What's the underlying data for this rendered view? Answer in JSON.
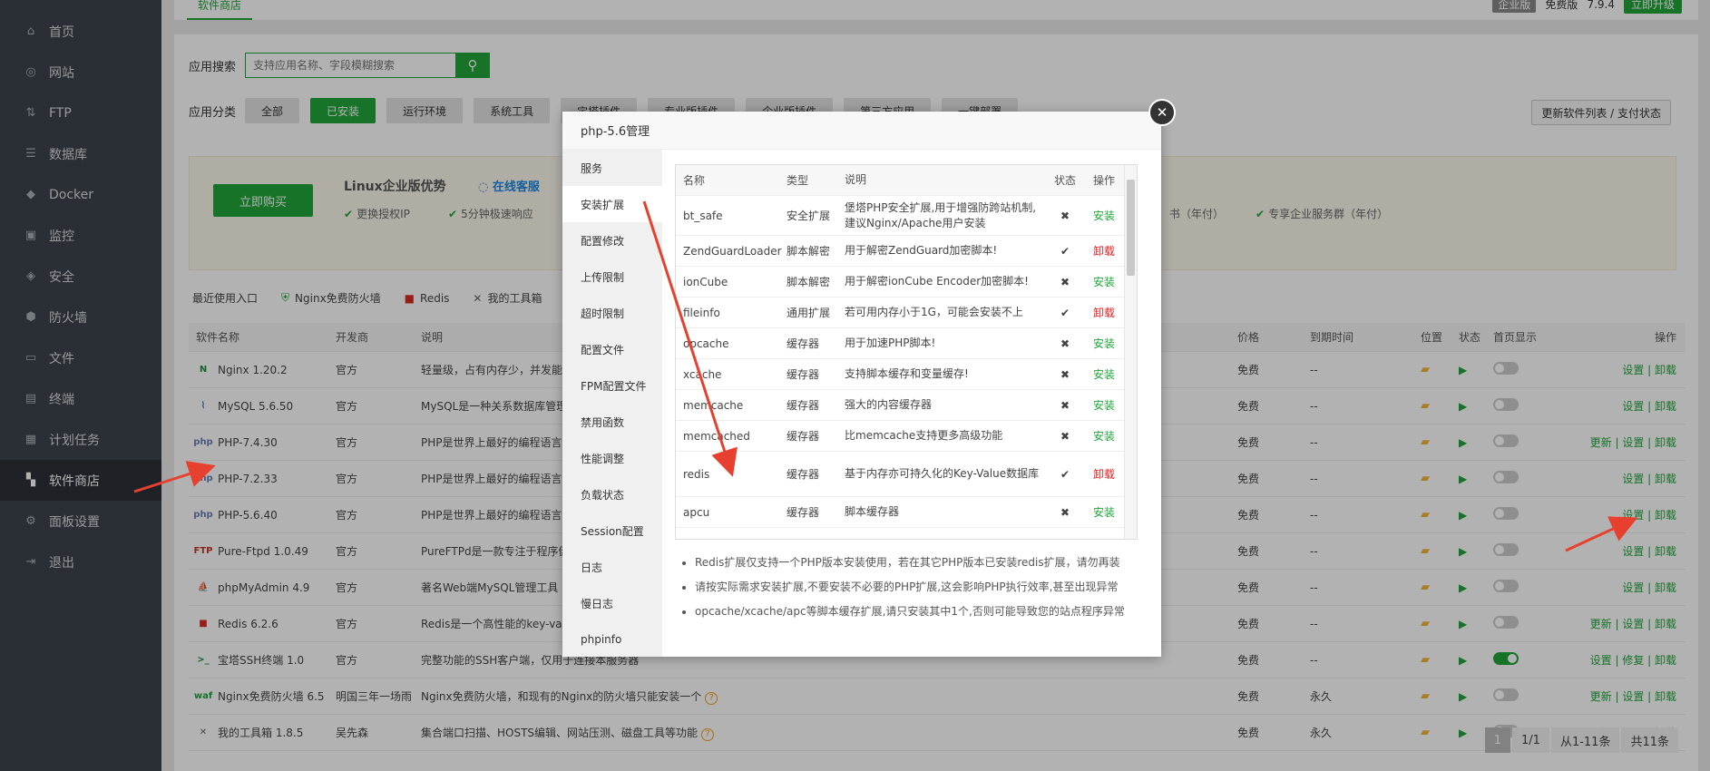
{
  "sidebar": {
    "items": [
      {
        "label": "首页",
        "icon": "home-icon",
        "glyph": "⌂"
      },
      {
        "label": "网站",
        "icon": "globe-icon",
        "glyph": "◎"
      },
      {
        "label": "FTP",
        "icon": "ftp-icon",
        "glyph": "⇅"
      },
      {
        "label": "数据库",
        "icon": "database-icon",
        "glyph": "☰"
      },
      {
        "label": "Docker",
        "icon": "docker-icon",
        "glyph": "◆"
      },
      {
        "label": "监控",
        "icon": "monitor-icon",
        "glyph": "▣"
      },
      {
        "label": "安全",
        "icon": "shield-check-icon",
        "glyph": "◈"
      },
      {
        "label": "防火墙",
        "icon": "firewall-icon",
        "glyph": "⬢"
      },
      {
        "label": "文件",
        "icon": "folder-icon",
        "glyph": "▭"
      },
      {
        "label": "终端",
        "icon": "terminal-icon",
        "glyph": "▤"
      },
      {
        "label": "计划任务",
        "icon": "calendar-icon",
        "glyph": "▦"
      },
      {
        "label": "软件商店",
        "icon": "app-store-icon",
        "glyph": "▚"
      },
      {
        "label": "面板设置",
        "icon": "settings-icon",
        "glyph": "⚙"
      },
      {
        "label": "退出",
        "icon": "logout-icon",
        "glyph": "⇥"
      }
    ],
    "active_index": 11
  },
  "topbar": {
    "tab": "软件商店",
    "edition": "企业版",
    "version_label": "免费版",
    "version": "7.9.4",
    "upgrade": "立即升级"
  },
  "search": {
    "label": "应用搜索",
    "placeholder": "支持应用名称、字段模糊搜索"
  },
  "category": {
    "label": "应用分类",
    "items": [
      "全部",
      "已安装",
      "运行环境",
      "系统工具",
      "宝塔插件",
      "专业版插件",
      "企业版插件",
      "第三方应用",
      "一键部署"
    ],
    "active_index": 1,
    "refresh": "更新软件列表 / 支付状态"
  },
  "promo": {
    "buy": "立即购买",
    "title": "Linux企业版优势",
    "service": "在线客服",
    "features": [
      "更换授权IP",
      "5分钟极速响应",
      "书（年付）",
      "专享企业服务群（年付）"
    ]
  },
  "recent": {
    "label": "最近使用入口",
    "items": [
      "Nginx免费防火墙",
      "Redis",
      "我的工具箱"
    ]
  },
  "table": {
    "headers": {
      "name": "软件名称",
      "dev": "开发商",
      "desc": "说明",
      "price": "价格",
      "expire": "到期时间",
      "position": "位置",
      "state": "状态",
      "home": "首页显示",
      "ops": "操作"
    },
    "rows": [
      {
        "name": "Nginx 1.20.2",
        "icon": "N",
        "icon_color": "#1e8e3e",
        "dev": "官方",
        "desc": "轻量级，占有内存少，并发能力强",
        "price": "免费",
        "expire": "--",
        "home_on": false,
        "ops": "设置 | 卸载",
        "help": false
      },
      {
        "name": "MySQL 5.6.50",
        "icon": "⌇",
        "icon_color": "#4479a1",
        "dev": "官方",
        "desc": "MySQL是一种关系数据库管理系统",
        "price": "免费",
        "expire": "--",
        "home_on": false,
        "ops": "设置 | 卸载",
        "help": false
      },
      {
        "name": "PHP-7.4.30",
        "icon": "php",
        "icon_color": "#6c7eb7",
        "dev": "官方",
        "desc": "PHP是世界上最好的编程语言",
        "price": "免费",
        "expire": "--",
        "home_on": false,
        "ops": "更新 | 设置 | 卸载",
        "help": false
      },
      {
        "name": "PHP-7.2.33",
        "icon": "php",
        "icon_color": "#6c7eb7",
        "dev": "官方",
        "desc": "PHP是世界上最好的编程语言",
        "price": "免费",
        "expire": "--",
        "home_on": false,
        "ops": "设置 | 卸载",
        "help": false
      },
      {
        "name": "PHP-5.6.40",
        "icon": "php",
        "icon_color": "#6c7eb7",
        "dev": "官方",
        "desc": "PHP是世界上最好的编程语言",
        "price": "免费",
        "expire": "--",
        "home_on": false,
        "ops": "设置 | 卸载",
        "help": false
      },
      {
        "name": "Pure-Ftpd 1.0.49",
        "icon": "FTP",
        "icon_color": "#c0392b",
        "dev": "官方",
        "desc": "PureFTPd是一款专注于程序健壮和软件安全的免费FTP服务器软件",
        "price": "免费",
        "expire": "--",
        "home_on": false,
        "ops": "设置 | 卸载",
        "help": false
      },
      {
        "name": "phpMyAdmin 4.9",
        "icon": "⛵",
        "icon_color": "#e67e22",
        "dev": "官方",
        "desc": "著名Web端MySQL管理工具",
        "price": "免费",
        "expire": "--",
        "home_on": false,
        "ops": "设置 | 卸载",
        "help": false
      },
      {
        "name": "Redis 6.2.6",
        "icon": "■",
        "icon_color": "#d82c20",
        "dev": "官方",
        "desc": "Redis是一个高性能的key-value数据库",
        "price": "免费",
        "expire": "--",
        "home_on": false,
        "ops": "更新 | 设置 | 卸载",
        "help": false
      },
      {
        "name": "宝塔SSH终端 1.0",
        "icon": ">_",
        "icon_color": "#1e8e3e",
        "dev": "官方",
        "desc": "完整功能的SSH客户端，仅用于连接本服务器",
        "price": "免费",
        "expire": "--",
        "home_on": true,
        "ops": "设置 | 修复 | 卸载",
        "help": false
      },
      {
        "name": "Nginx免费防火墙 6.5",
        "icon": "waf",
        "icon_color": "#20a53a",
        "dev": "明国三年一场雨",
        "desc": "Nginx免费防火墙，和现有的Nginx的防火墙只能安装一个",
        "price": "免费",
        "expire": "永久",
        "home_on": false,
        "ops": "更新 | 设置 | 卸载",
        "help": true
      },
      {
        "name": "我的工具箱 1.8.5",
        "icon": "✕",
        "icon_color": "#666666",
        "dev": "吴先森",
        "desc": "集合端口扫描、HOSTS编辑、网站压测、磁盘工具等功能",
        "price": "免费",
        "expire": "永久",
        "home_on": false,
        "ops": "更新 | 设置 | 卸载",
        "help": true
      }
    ]
  },
  "pager": {
    "page": "1",
    "pages": "1/1",
    "range": "从1-11条",
    "total": "共11条"
  },
  "modal": {
    "title": "php-5.6管理",
    "menu": [
      "服务",
      "安装扩展",
      "配置修改",
      "上传限制",
      "超时限制",
      "配置文件",
      "FPM配置文件",
      "禁用函数",
      "性能调整",
      "负载状态",
      "Session配置",
      "日志",
      "慢日志",
      "phpinfo"
    ],
    "active_index": 1,
    "ext_headers": {
      "name": "名称",
      "type": "类型",
      "desc": "说明",
      "state": "状态",
      "op": "操作"
    },
    "extensions": [
      {
        "name": "bt_safe",
        "type": "安全扩展",
        "desc": "堡塔PHP安全扩展,用于增强防跨站机制,建议Nginx/Apache用户安装",
        "installed": false,
        "op": "安装",
        "h": 44
      },
      {
        "name": "ZendGuardLoader",
        "type": "脚本解密",
        "desc": "用于解密ZendGuard加密脚本!",
        "installed": true,
        "op": "卸载",
        "h": 34
      },
      {
        "name": "ionCube",
        "type": "脚本解密",
        "desc": "用于解密ionCube Encoder加密脚本!",
        "installed": false,
        "op": "安装",
        "h": 34
      },
      {
        "name": "fileinfo",
        "type": "通用扩展",
        "desc": "若可用内存小于1G，可能会安装不上",
        "installed": true,
        "op": "卸载",
        "h": 34
      },
      {
        "name": "opcache",
        "type": "缓存器",
        "desc": "用于加速PHP脚本!",
        "installed": false,
        "op": "安装",
        "h": 34
      },
      {
        "name": "xcache",
        "type": "缓存器",
        "desc": "支持脚本缓存和变量缓存!",
        "installed": false,
        "op": "安装",
        "h": 34
      },
      {
        "name": "memcache",
        "type": "缓存器",
        "desc": "强大的内容缓存器",
        "installed": false,
        "op": "安装",
        "h": 34
      },
      {
        "name": "memcached",
        "type": "缓存器",
        "desc": "比memcache支持更多高级功能",
        "installed": false,
        "op": "安装",
        "h": 34
      },
      {
        "name": "redis",
        "type": "缓存器",
        "desc": "基于内存亦可持久化的Key-Value数据库",
        "installed": true,
        "op": "卸载",
        "h": 50
      },
      {
        "name": "apcu",
        "type": "缓存器",
        "desc": "脚本缓存器",
        "installed": false,
        "op": "安装",
        "h": 34
      }
    ],
    "notes": [
      "Redis扩展仅支持一个PHP版本安装使用，若在其它PHP版本已安装redis扩展，请勿再装",
      "请按实际需求安装扩展,不要安装不必要的PHP扩展,这会影响PHP执行效率,甚至出现异常",
      "opcache/xcache/apc等脚本缓存扩展,请只安装其中1个,否则可能导致您的站点程序异常"
    ]
  },
  "colors": {
    "accent": "#20a53a",
    "danger": "#e02020",
    "sidebar": "#3c444d",
    "arrow": "#e8402f"
  }
}
